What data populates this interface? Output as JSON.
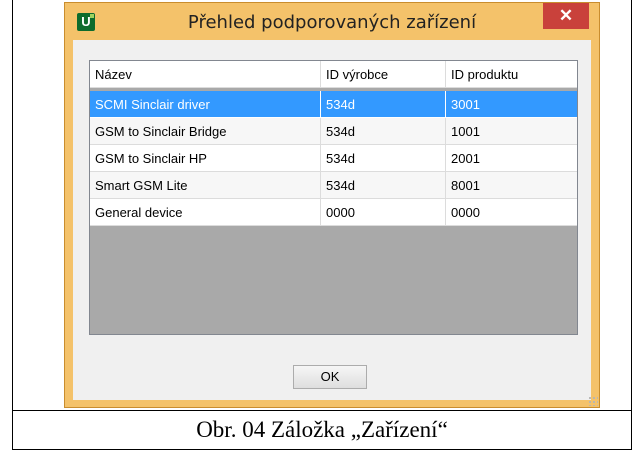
{
  "window": {
    "title": "Přehled podporovaných zařízení",
    "icon_letter": "U",
    "close_glyph": "✕"
  },
  "table": {
    "columns": [
      "Název",
      "ID výrobce",
      "ID produktu"
    ],
    "rows": [
      {
        "name": "SCMI Sinclair driver",
        "vendor_id": "534d",
        "product_id": "3001",
        "selected": true
      },
      {
        "name": "GSM to Sinclair Bridge",
        "vendor_id": "534d",
        "product_id": "1001"
      },
      {
        "name": "GSM to Sinclair HP",
        "vendor_id": "534d",
        "product_id": "2001"
      },
      {
        "name": "Smart GSM Lite",
        "vendor_id": "534d",
        "product_id": "8001"
      },
      {
        "name": "General device",
        "vendor_id": "0000",
        "product_id": "0000"
      }
    ]
  },
  "buttons": {
    "ok_label": "OK"
  },
  "caption": "Obr. 04 Záložka „Zařízení“",
  "colors": {
    "frame": "#f4c26a",
    "selection": "#3399ff",
    "close": "#c9413b",
    "empty_area": "#a9a9a9"
  }
}
